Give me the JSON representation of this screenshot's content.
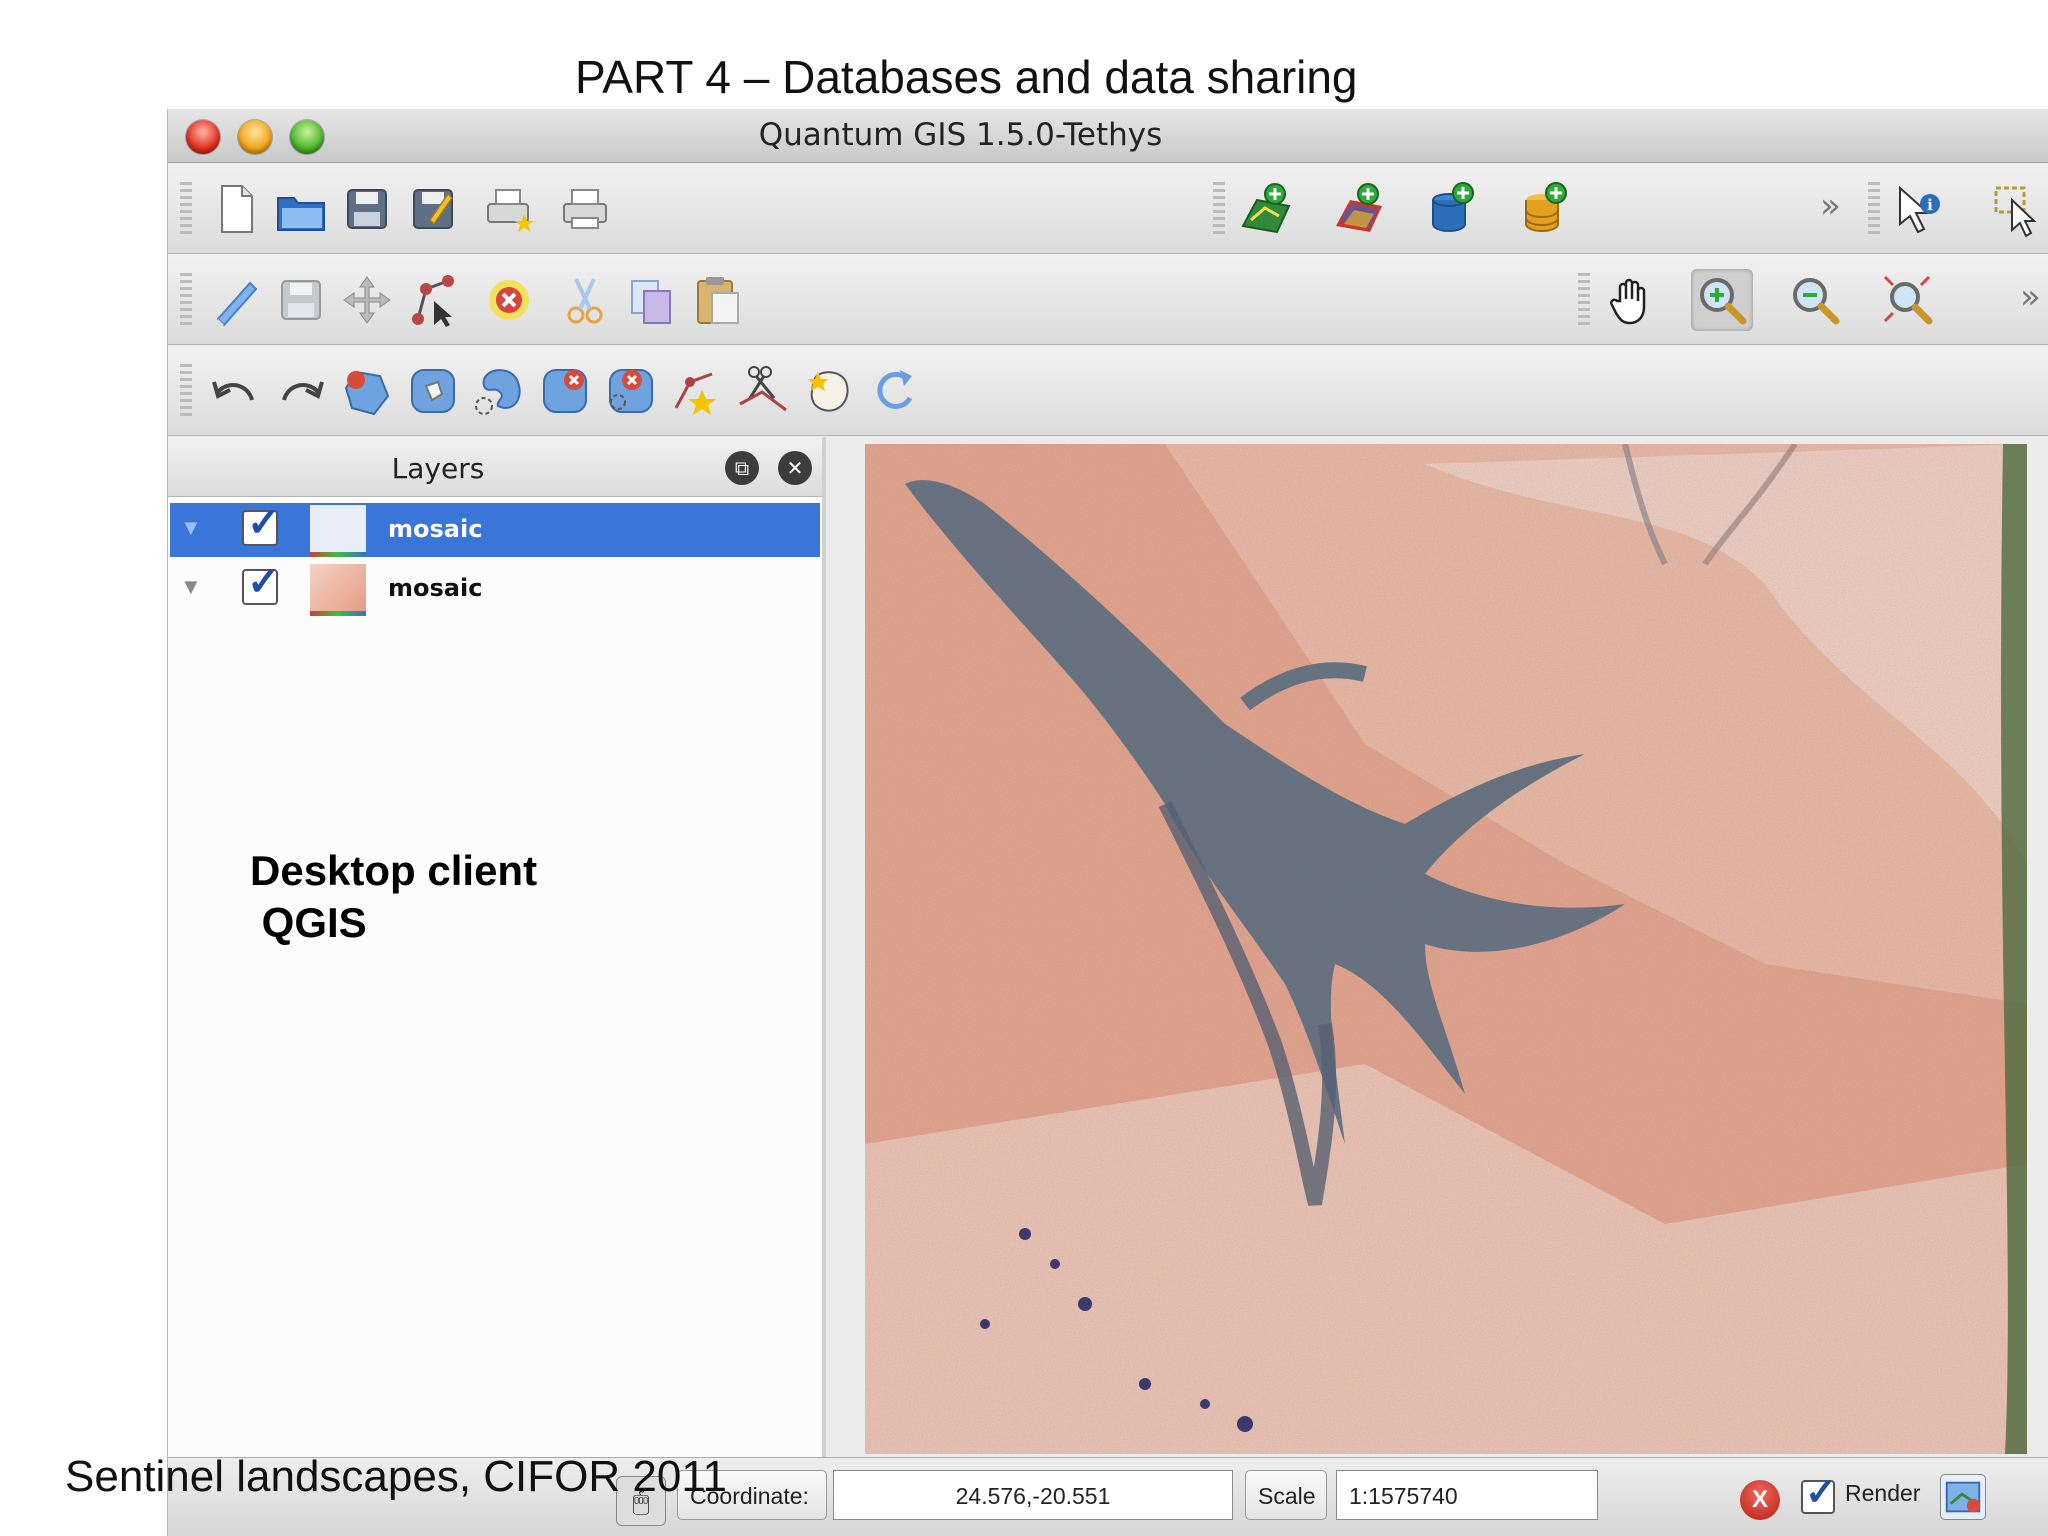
{
  "slide": {
    "title": "PART 4 – Databases and data sharing",
    "footer": "Sentinel landscapes, CIFOR 2011",
    "annotation": "Desktop client\n QGIS"
  },
  "window": {
    "title": "Quantum GIS 1.5.0-Tethys"
  },
  "toolbar1": {
    "icons": [
      "new-project-icon",
      "open-project-icon",
      "save-project-icon",
      "save-as-icon",
      "new-print-composer-icon",
      "print-composer-icon",
      "add-vector-layer-icon",
      "add-raster-layer-icon",
      "add-postgis-layer-icon",
      "add-spatialite-layer-icon",
      "identify-icon",
      "select-icon"
    ],
    "overflow": "»"
  },
  "toolbar2": {
    "icons": [
      "toggle-editing-icon",
      "save-edits-icon",
      "move-feature-icon",
      "node-tool-icon",
      "delete-selected-icon",
      "cut-features-icon",
      "copy-features-icon",
      "paste-features-icon",
      "pan-icon",
      "zoom-in-icon",
      "zoom-out-icon",
      "zoom-full-icon"
    ],
    "overflow": "»"
  },
  "toolbar3": {
    "icons": [
      "undo-icon",
      "redo-icon",
      "simplify-feature-icon",
      "add-ring-icon",
      "add-part-icon",
      "delete-ring-icon",
      "delete-part-icon",
      "reshape-features-icon",
      "split-features-icon",
      "merge-features-icon",
      "rotate-symbol-icon"
    ]
  },
  "layers_panel": {
    "title": "Layers",
    "layers": [
      {
        "name": "mosaic",
        "checked": "✓",
        "selected": true
      },
      {
        "name": "mosaic",
        "checked": "✓",
        "selected": false
      }
    ]
  },
  "statusbar": {
    "coordinate_label": "Coordinate:",
    "coordinate_value": "24.576,-20.551",
    "scale_label": "Scale",
    "scale_value": "1:1575740",
    "stop_label": "X",
    "render_checked": "✓",
    "render_label": "Render"
  },
  "colors": {
    "selection": "#3a75d9",
    "map_base": "#e9a78e",
    "wetland": "#5d6f80"
  }
}
